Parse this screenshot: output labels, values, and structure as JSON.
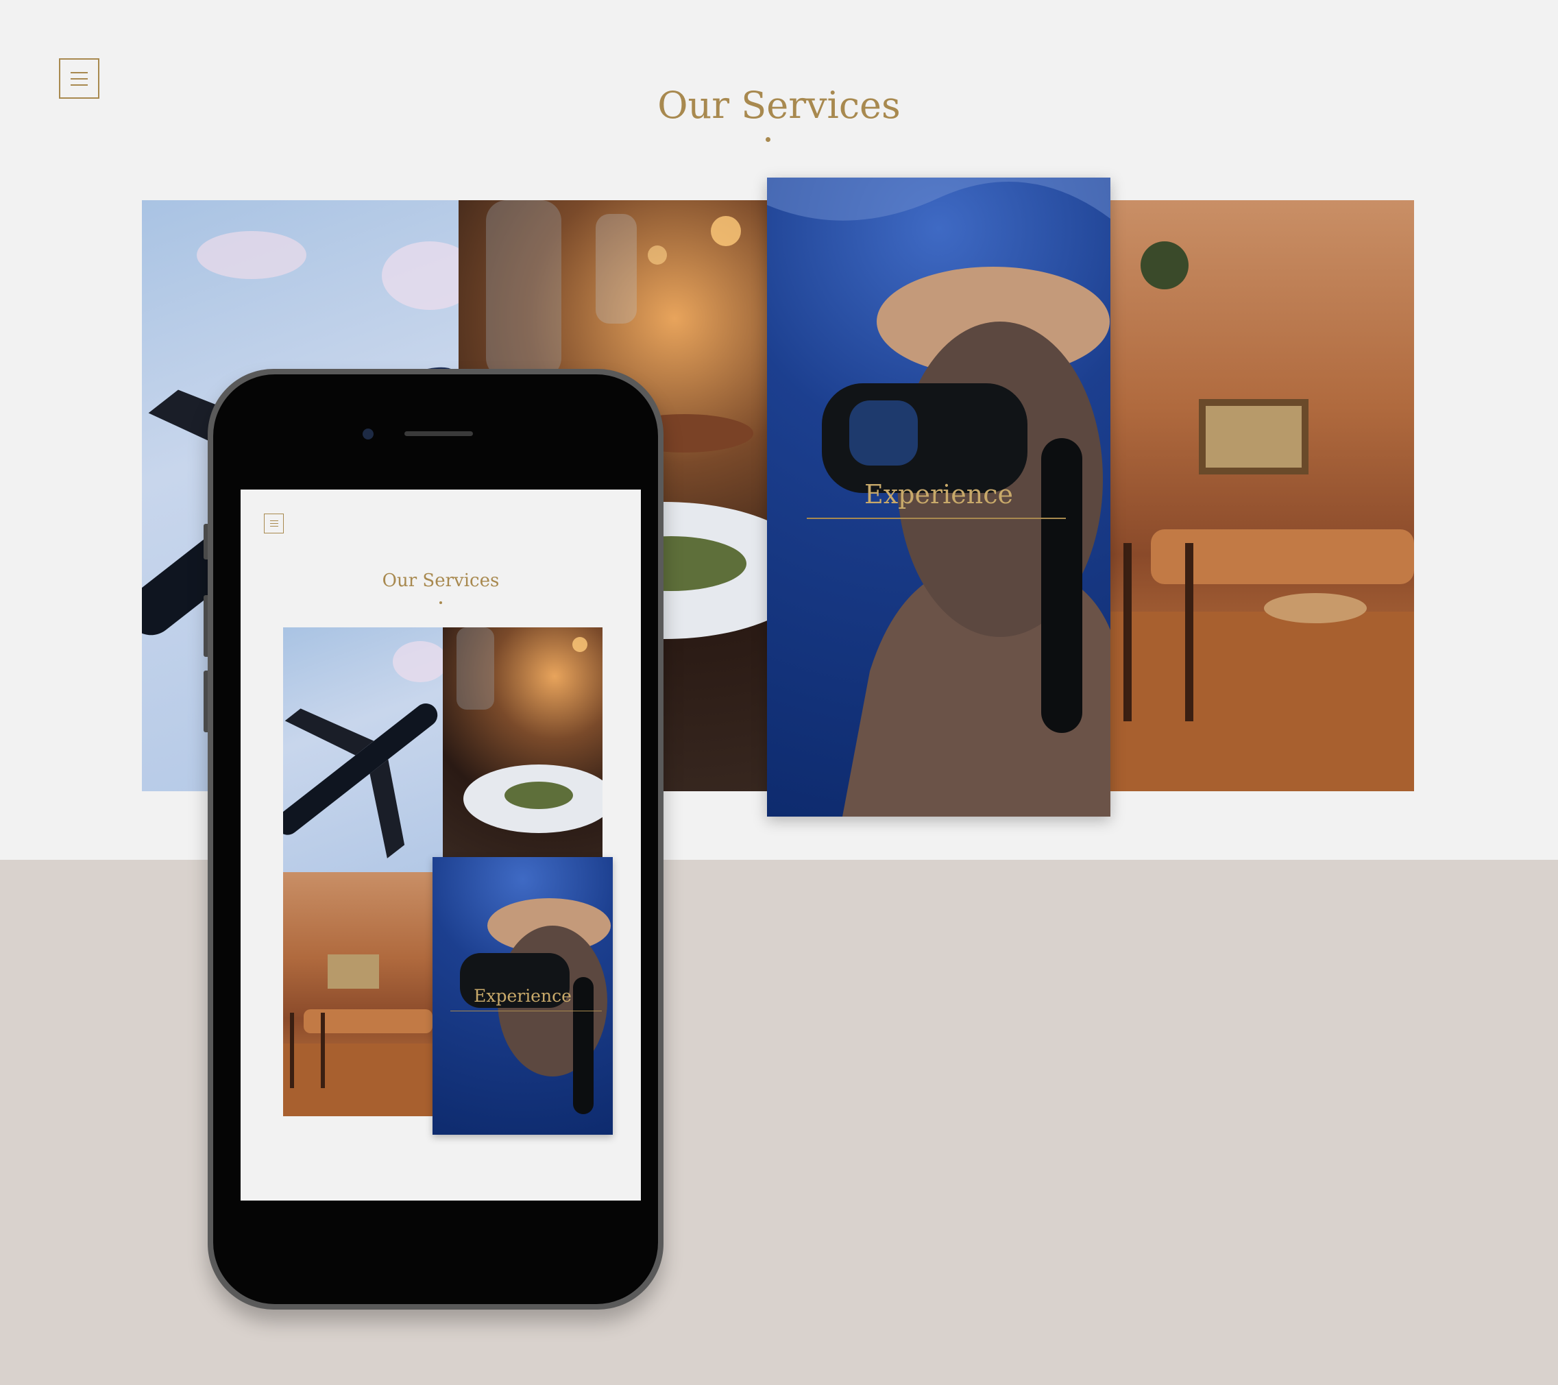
{
  "header": {
    "title": "Our Services",
    "menu_icon": "hamburger-menu-icon"
  },
  "services": [
    {
      "image": "airplane-in-sky",
      "caption": ""
    },
    {
      "image": "fine-dining-table",
      "caption": ""
    },
    {
      "image": "scuba-diver-underwater",
      "caption": "Experience"
    },
    {
      "image": "luxury-lounge-interior",
      "caption": ""
    }
  ],
  "phone": {
    "screen": {
      "title": "Our Services",
      "menu_icon": "hamburger-menu-icon",
      "featured_caption": "Experience"
    }
  },
  "colors": {
    "accent_gold": "#a8894f",
    "background": "#f2f2f2",
    "bottom_band": "#d9d2cd"
  }
}
